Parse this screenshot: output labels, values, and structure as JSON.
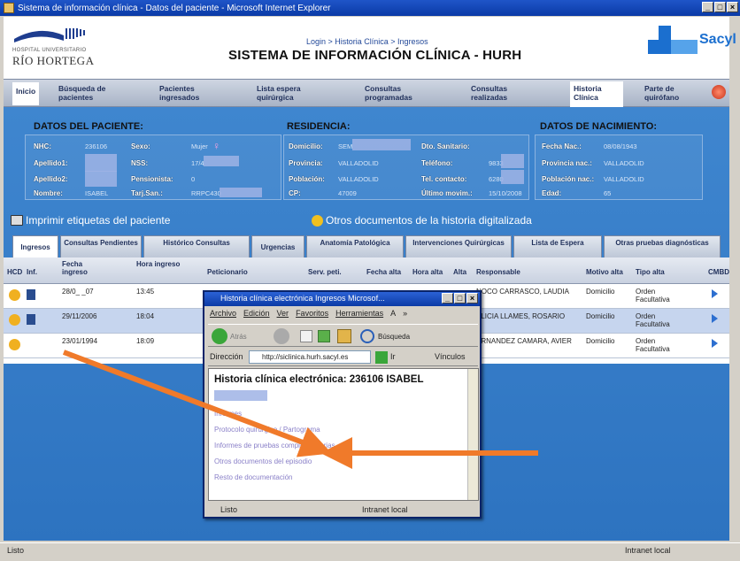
{
  "window": {
    "title": "Sistema de información clínica - Datos del paciente - Microsoft Internet Explorer"
  },
  "header": {
    "hospital_small": "HOSPITAL UNIVERSITARIO",
    "hospital_name": "RÍO HORTEGA",
    "breadcrumb": "Login > Historia Clínica > Ingresos",
    "system_title": "SISTEMA DE INFORMACIÓN CLÍNICA - HURH",
    "brand": "Sacyl"
  },
  "nav": [
    {
      "label": "Inicio"
    },
    {
      "label": "Búsqueda de pacientes"
    },
    {
      "label": "Pacientes ingresados"
    },
    {
      "label": "Lista espera quirúrgica"
    },
    {
      "label": "Consultas programadas"
    },
    {
      "label": "Consultas realizadas"
    },
    {
      "label": "Historia Clínica"
    },
    {
      "label": "Parte de quirófano"
    }
  ],
  "patient": {
    "title": "DATOS DEL PACIENTE:",
    "nhc_label": "NHC:",
    "nhc": "236106",
    "sexo_label": "Sexo:",
    "sexo": "Mujer",
    "apellido1_label": "Apellido1:",
    "nss_label": "NSS:",
    "nss": "17/4",
    "apellido2_label": "Apellido2:",
    "pensionista_label": "Pensionista:",
    "pensionista": "0",
    "nombre_label": "Nombre:",
    "nombre": "ISABEL",
    "tarj_label": "Tarj.San.:",
    "tarj": "RRPC430"
  },
  "residence": {
    "title": "RESIDENCIA:",
    "domicilio_label": "Domicilio:",
    "domicilio": "SEM",
    "provincia_label": "Provincia:",
    "provincia": "VALLADOLID",
    "poblacion_label": "Población:",
    "poblacion": "VALLADOLID",
    "cp_label": "CP:",
    "cp": "47009",
    "dto_label": "Dto. Sanitario:",
    "telefono_label": "Teléfono:",
    "telefono": "9833",
    "contacto_label": "Tel. contacto:",
    "contacto": "6280",
    "ultimo_label": "Último movim.:",
    "ultimo": "15/10/2008"
  },
  "birth": {
    "title": "DATOS DE NACIMIENTO:",
    "fecha_label": "Fecha Nac.:",
    "fecha": "08/08/1943",
    "provincia_label": "Provincia nac.:",
    "provincia": "VALLADOLID",
    "poblacion_label": "Población nac.:",
    "poblacion": "VALLADOLID",
    "edad_label": "Edad:",
    "edad": "65"
  },
  "links": {
    "print": "Imprimir etiquetas del paciente",
    "documents": "Otros documentos de la historia digitalizada"
  },
  "tabs": [
    {
      "label": "Ingresos"
    },
    {
      "label": "Consultas Pendientes"
    },
    {
      "label": "Histórico Consultas"
    },
    {
      "label": "Urgencias"
    },
    {
      "label": "Anatomía Patológica"
    },
    {
      "label": "Intervenciones Quirúrgicas"
    },
    {
      "label": "Lista de Espera"
    },
    {
      "label": "Otras pruebas diagnósticas"
    }
  ],
  "grid": {
    "headers": [
      "HCD",
      "Inf.",
      "Fecha ingreso",
      "Hora ingreso",
      "Peticionario",
      "Serv. peti.",
      "Fecha alta",
      "Hora alta",
      "Alta",
      "Responsable",
      "Motivo alta",
      "Tipo alta",
      "CMBD"
    ],
    "rows": [
      {
        "fecha": "28/0_ _07",
        "hora": "13:45",
        "responsable": "NOCO CARRASCO, LAUDIA",
        "motivo": "Domicilio",
        "tipo": "Orden Facultativa"
      },
      {
        "fecha": "29/11/2006",
        "hora": "18:04",
        "responsable": "ELICIA LLAMES, ROSARIO",
        "motivo": "Domicilio",
        "tipo": "Orden Facultativa"
      },
      {
        "fecha": "23/01/1994",
        "hora": "18:09",
        "responsable": "ERNANDEZ CAMARA, AVIER",
        "motivo": "Domicilio",
        "tipo": "Orden Facultativa"
      }
    ]
  },
  "popup": {
    "title": "Historia clínica electrónica   Ingresos   Microsof...",
    "menu": [
      "Archivo",
      "Edición",
      "Ver",
      "Favoritos",
      "Herramientas",
      "A",
      "»"
    ],
    "back": "Atrás",
    "search": "Búsqueda",
    "address_label": "Dirección",
    "address": "http://siclinica.hurh.sacyl.es",
    "go": "Ir",
    "links_label": "Vínculos",
    "heading": "Historia clínica electrónica: 236106 ISABEL",
    "items": [
      "Informes",
      "Protocolo quirúrgico / Partograma",
      "Informes de pruebas complementarias",
      "Otros documentos del episodio",
      "Resto de documentación"
    ],
    "status": "Listo",
    "zone": "Intranet local"
  },
  "statusbar": {
    "left": "Listo",
    "right": "Intranet local"
  },
  "colors": {
    "main_bg": "#3f86cf",
    "arrow": "#f07a2a",
    "title_bar": "#0a3aa6"
  }
}
